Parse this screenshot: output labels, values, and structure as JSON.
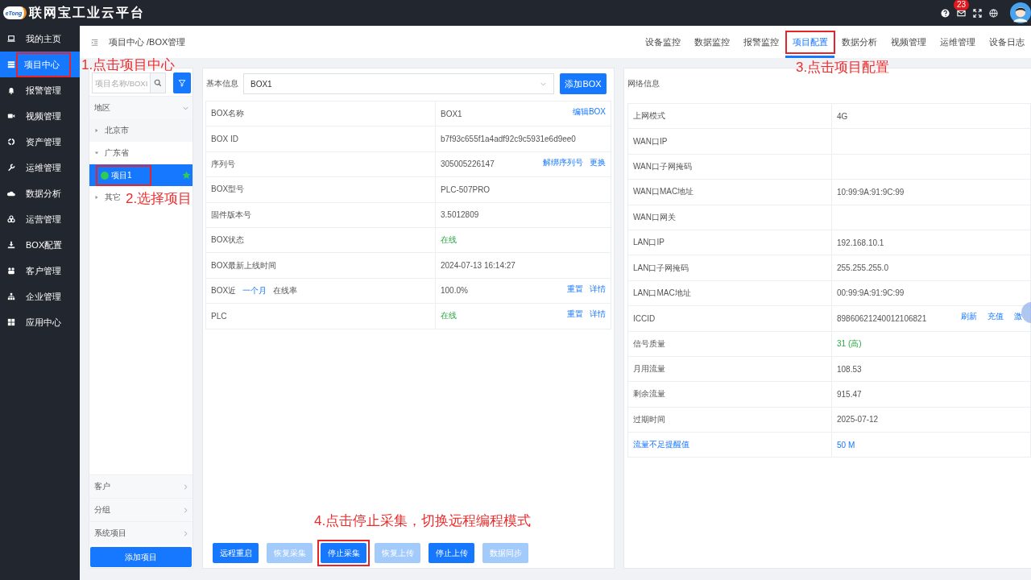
{
  "topbar": {
    "logo_text": "eTong",
    "title": "联网宝工业云平台",
    "mail_badge": "23"
  },
  "nav": [
    {
      "label": "我的主页",
      "selected": false,
      "highlighted": false
    },
    {
      "label": "项目中心",
      "selected": true,
      "highlighted": true
    },
    {
      "label": "报警管理",
      "selected": false,
      "highlighted": false
    },
    {
      "label": "视频管理",
      "selected": false,
      "highlighted": false
    },
    {
      "label": "资产管理",
      "selected": false,
      "highlighted": false
    },
    {
      "label": "运维管理",
      "selected": false,
      "highlighted": false
    },
    {
      "label": "数据分析",
      "selected": false,
      "highlighted": false
    },
    {
      "label": "运营管理",
      "selected": false,
      "highlighted": false
    },
    {
      "label": "BOX配置",
      "selected": false,
      "highlighted": false
    },
    {
      "label": "客户管理",
      "selected": false,
      "highlighted": false
    },
    {
      "label": "企业管理",
      "selected": false,
      "highlighted": false
    },
    {
      "label": "应用中心",
      "selected": false,
      "highlighted": false
    }
  ],
  "breadcrumb": "项目中心 /BOX管理",
  "tabs": [
    {
      "label": "设备监控",
      "selected": false,
      "highlighted": false
    },
    {
      "label": "数据监控",
      "selected": false,
      "highlighted": false
    },
    {
      "label": "报警监控",
      "selected": false,
      "highlighted": false
    },
    {
      "label": "项目配置",
      "selected": true,
      "highlighted": true
    },
    {
      "label": "数据分析",
      "selected": false,
      "highlighted": false
    },
    {
      "label": "视频管理",
      "selected": false,
      "highlighted": false
    },
    {
      "label": "运维管理",
      "selected": false,
      "highlighted": false
    },
    {
      "label": "设备日志",
      "selected": false,
      "highlighted": false
    }
  ],
  "project_panel": {
    "search": {
      "placeholder": "项目名称/BOXI"
    },
    "group_header": "地区",
    "tree": [
      {
        "label": "北京市",
        "expanded": false
      },
      {
        "label": "广东省",
        "expanded": true,
        "children": [
          {
            "label": "项目1",
            "selected": true,
            "highlighted": true,
            "online": true,
            "starred": true
          }
        ]
      },
      {
        "label": "其它",
        "expanded": false
      }
    ],
    "footer_groups": [
      "客户",
      "分组",
      "系统项目"
    ],
    "add_button": "添加项目"
  },
  "box_panel": {
    "label": "基本信息",
    "select_value": "BOX1",
    "add_button": "添加BOX",
    "rows": [
      {
        "kind": "text",
        "label": "BOX名称",
        "value": "BOX1",
        "actions": [
          "编辑BOX"
        ]
      },
      {
        "kind": "text",
        "label": "BOX ID",
        "value": "b7f93c655f1a4adf92c9c5931e6d9ee0",
        "actions": []
      },
      {
        "kind": "text",
        "label": "序列号",
        "value": "305005226147",
        "actions": [
          "解绑序列号",
          "更换"
        ]
      },
      {
        "kind": "text",
        "label": "BOX型号",
        "value": "PLC-507PRO",
        "actions": []
      },
      {
        "kind": "text",
        "label": "固件版本号",
        "value": "3.5012809",
        "actions": []
      },
      {
        "kind": "status",
        "label": "BOX状态",
        "value": "在线",
        "actions": []
      },
      {
        "kind": "text",
        "label": "BOX最新上线时间",
        "value": "2024-07-13 16:14:27",
        "actions": []
      },
      {
        "kind": "text",
        "label": "BOX近",
        "label_link": "一个月",
        "label_after": "在线率",
        "value": "100.0%",
        "actions": [
          "重置",
          "详情"
        ]
      },
      {
        "kind": "status",
        "label": "PLC",
        "value": "在线",
        "actions": [
          "重置",
          "详情"
        ]
      }
    ],
    "buttons": [
      {
        "label": "远程重启",
        "disabled": false,
        "highlighted": false
      },
      {
        "label": "恢复采集",
        "disabled": true,
        "highlighted": false
      },
      {
        "label": "停止采集",
        "disabled": false,
        "highlighted": true
      },
      {
        "label": "恢复上传",
        "disabled": true,
        "highlighted": false
      },
      {
        "label": "停止上传",
        "disabled": false,
        "highlighted": false
      },
      {
        "label": "数据同步",
        "disabled": true,
        "highlighted": false
      }
    ]
  },
  "network_panel": {
    "title": "网络信息",
    "rows": [
      {
        "kind": "text",
        "label": "上网模式",
        "value": "4G",
        "actions": []
      },
      {
        "kind": "text",
        "label": "WAN口IP",
        "actions": []
      },
      {
        "kind": "text",
        "label": "WAN口子网掩码",
        "actions": []
      },
      {
        "kind": "text",
        "label": "WAN口MAC地址",
        "value": "10:99:9A:91:9C:99",
        "actions": []
      },
      {
        "kind": "text",
        "label": "WAN口网关",
        "actions": []
      },
      {
        "kind": "text",
        "label": "LAN口IP",
        "value": "192.168.10.1",
        "actions": []
      },
      {
        "kind": "text",
        "label": "LAN口子网掩码",
        "value": "255.255.255.0",
        "actions": []
      },
      {
        "kind": "text",
        "label": "LAN口MAC地址",
        "value": "00:99:9A:91:9C:99",
        "actions": []
      },
      {
        "kind": "text",
        "label": "ICCID",
        "value": "89860621240012106821",
        "actions": [
          "刷新",
          "充值",
          "激"
        ]
      },
      {
        "kind": "status",
        "label": "信号质量",
        "value": "31 (高)",
        "actions": []
      },
      {
        "kind": "text",
        "label": "月用流量",
        "value": "108.53",
        "actions": []
      },
      {
        "kind": "text",
        "label": "剩余流量",
        "value": "915.47",
        "actions": []
      },
      {
        "kind": "text",
        "label": "过期时间",
        "value": "2025-07-12",
        "actions": []
      },
      {
        "kind": "link",
        "label": "流量不足提醒值",
        "value": "50  M",
        "actions": []
      }
    ]
  },
  "annotations": [
    "1.点击项目中心",
    "2.选择项目",
    "3.点击项目配置",
    "4.点击停止采集，切换远程编程模式"
  ]
}
